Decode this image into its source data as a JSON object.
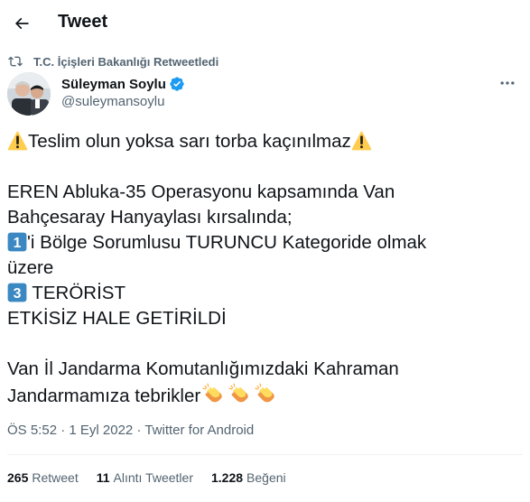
{
  "header": {
    "title": "Tweet"
  },
  "retweet": {
    "label": "T.C. İçişleri Bakanlığı Retweetledi"
  },
  "author": {
    "name": "Süleyman Soylu",
    "handle": "@suleymansoylu"
  },
  "tweet": {
    "line1": "Teslim olun yoksa sarı torba kaçınılmaz",
    "line2": "EREN Abluka-35 Operasyonu kapsamında Van",
    "line3": "Bahçesaray Hanyaylası kırsalında;",
    "line4": "'i Bölge Sorumlusu TURUNCU Kategoride olmak",
    "line5": "üzere",
    "line6": " TERÖRİST",
    "line7": "ETKİSİZ HALE GETİRİLDİ",
    "line8": "Van İl Jandarma Komutanlığımızdaki Kahraman",
    "line9": "Jandarmamıza tebrikler",
    "keycap1": "1",
    "keycap3": "3"
  },
  "meta": {
    "time": "ÖS 5:52",
    "sep1": " · ",
    "date": "1 Eyl 2022",
    "sep2": " · ",
    "source": "Twitter for Android"
  },
  "stats": {
    "retweets": {
      "count": "265",
      "label": "Retweet"
    },
    "quotes": {
      "count": "11",
      "label": "Alıntı Tweetler"
    },
    "likes": {
      "count": "1.228",
      "label": "Beğeni"
    }
  },
  "icons": {
    "back": "arrow-left-icon",
    "retweet": "retweet-icon",
    "verified": "verified-badge-icon",
    "more": "more-icon",
    "warning": "warning-emoji-icon",
    "clap": "clapping-hands-emoji-icon"
  },
  "colors": {
    "verified": "#1d9bf0",
    "secondary_text": "#536471",
    "keycap": "#3b88c3",
    "warning": "#ffcc4d"
  }
}
